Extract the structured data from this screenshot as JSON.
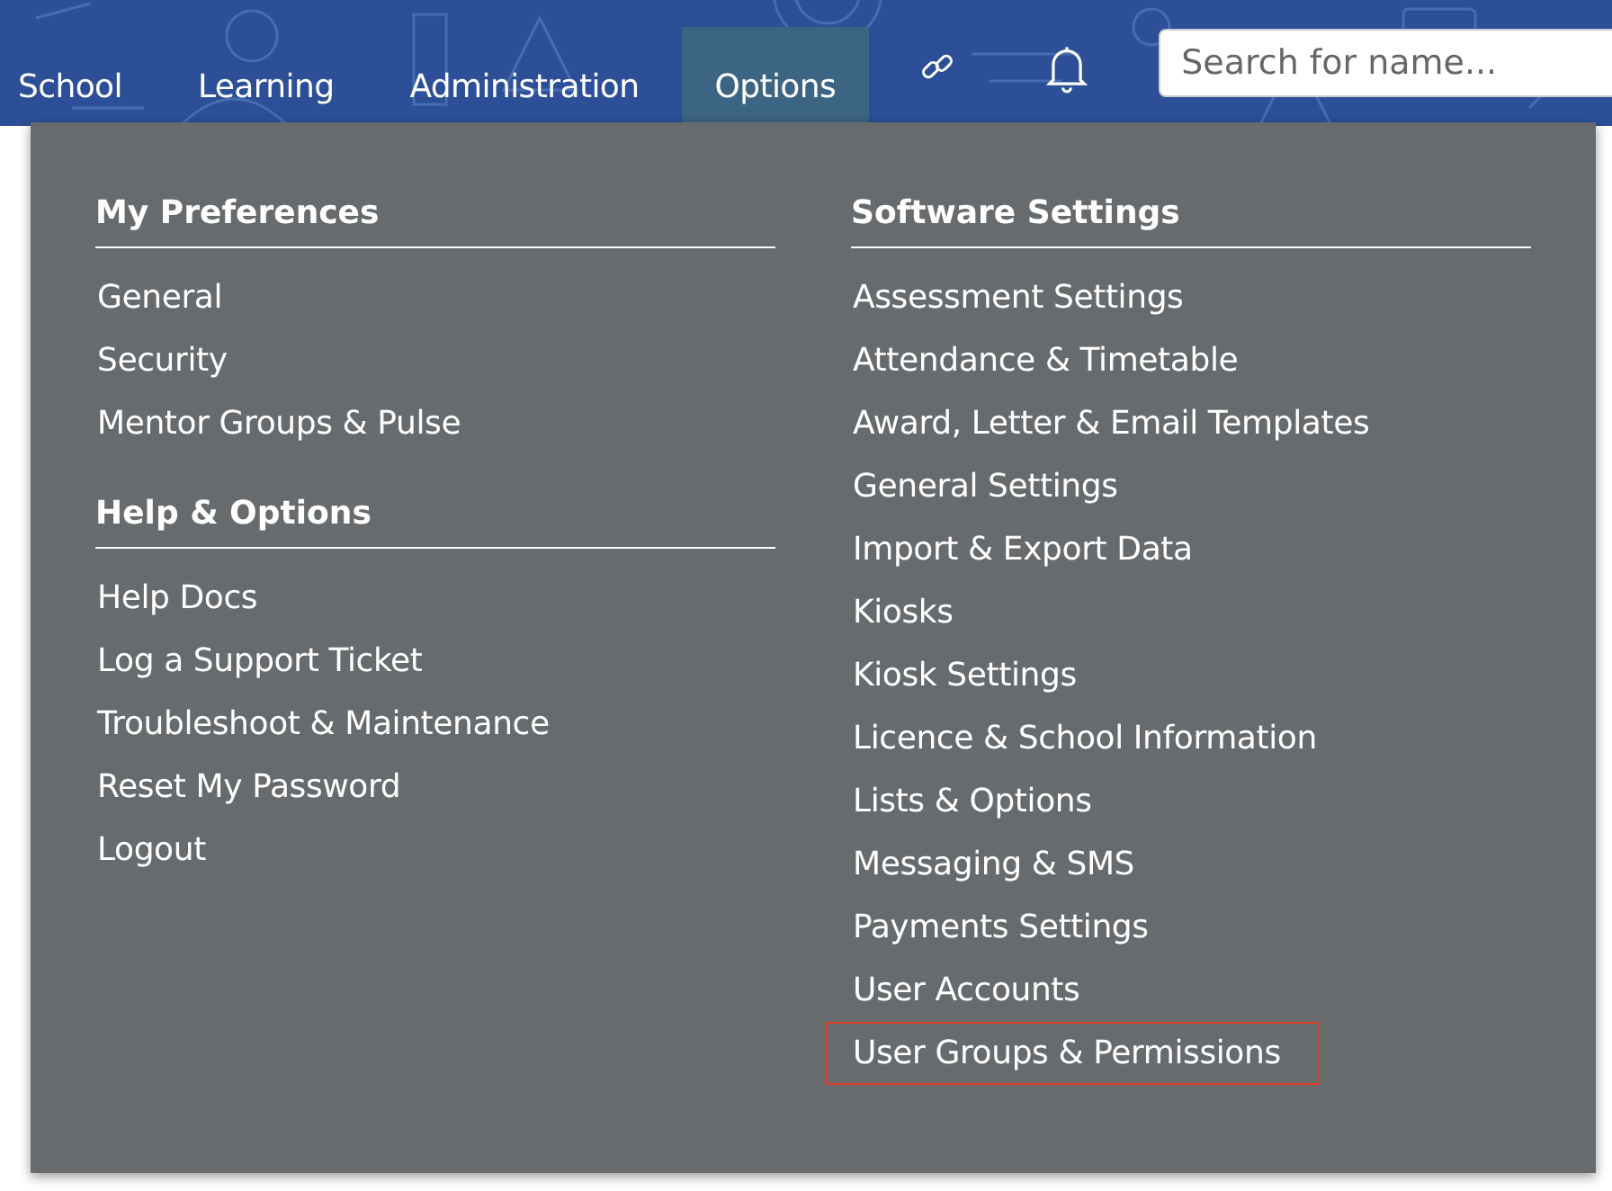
{
  "nav": {
    "items": [
      {
        "label": "School",
        "selected": false
      },
      {
        "label": "Learning",
        "selected": false
      },
      {
        "label": "Administration",
        "selected": false
      },
      {
        "label": "Options",
        "selected": true
      }
    ],
    "search": {
      "placeholder": "Search for name..."
    }
  },
  "menu": {
    "columns": [
      {
        "sections": [
          {
            "heading": "My Preferences",
            "items": [
              {
                "label": "General",
                "highlighted": false
              },
              {
                "label": "Security",
                "highlighted": false
              },
              {
                "label": "Mentor Groups & Pulse",
                "highlighted": false
              }
            ]
          },
          {
            "heading": "Help & Options",
            "items": [
              {
                "label": "Help Docs",
                "highlighted": false
              },
              {
                "label": "Log a Support Ticket",
                "highlighted": false
              },
              {
                "label": "Troubleshoot & Maintenance",
                "highlighted": false
              },
              {
                "label": "Reset My Password",
                "highlighted": false
              },
              {
                "label": "Logout",
                "highlighted": false
              }
            ]
          }
        ]
      },
      {
        "sections": [
          {
            "heading": "Software Settings",
            "items": [
              {
                "label": "Assessment Settings",
                "highlighted": false
              },
              {
                "label": "Attendance & Timetable",
                "highlighted": false
              },
              {
                "label": "Award, Letter & Email Templates",
                "highlighted": false
              },
              {
                "label": "General Settings",
                "highlighted": false
              },
              {
                "label": "Import & Export Data",
                "highlighted": false
              },
              {
                "label": "Kiosks",
                "highlighted": false
              },
              {
                "label": "Kiosk Settings",
                "highlighted": false
              },
              {
                "label": "Licence & School Information",
                "highlighted": false
              },
              {
                "label": "Lists & Options",
                "highlighted": false
              },
              {
                "label": "Messaging & SMS",
                "highlighted": false
              },
              {
                "label": "Payments Settings",
                "highlighted": false
              },
              {
                "label": "User Accounts",
                "highlighted": false
              },
              {
                "label": "User Groups & Permissions",
                "highlighted": true
              }
            ]
          }
        ]
      }
    ]
  }
}
